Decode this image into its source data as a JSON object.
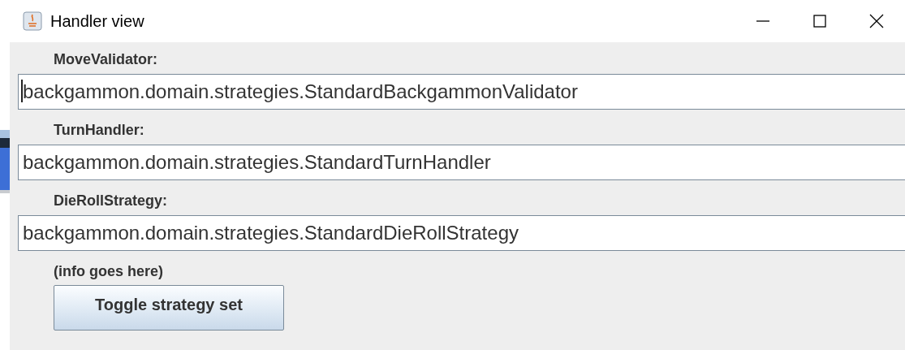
{
  "window": {
    "title": "Handler view"
  },
  "fields": [
    {
      "label": "MoveValidator:",
      "value": "backgammon.domain.strategies.StandardBackgammonValidator",
      "focused": true
    },
    {
      "label": "TurnHandler:",
      "value": "backgammon.domain.strategies.StandardTurnHandler",
      "focused": false
    },
    {
      "label": "DieRollStrategy:",
      "value": "backgammon.domain.strategies.StandardDieRollStrategy",
      "focused": false
    }
  ],
  "info": "(info goes here)",
  "buttons": [
    "Toggle strategy set"
  ]
}
